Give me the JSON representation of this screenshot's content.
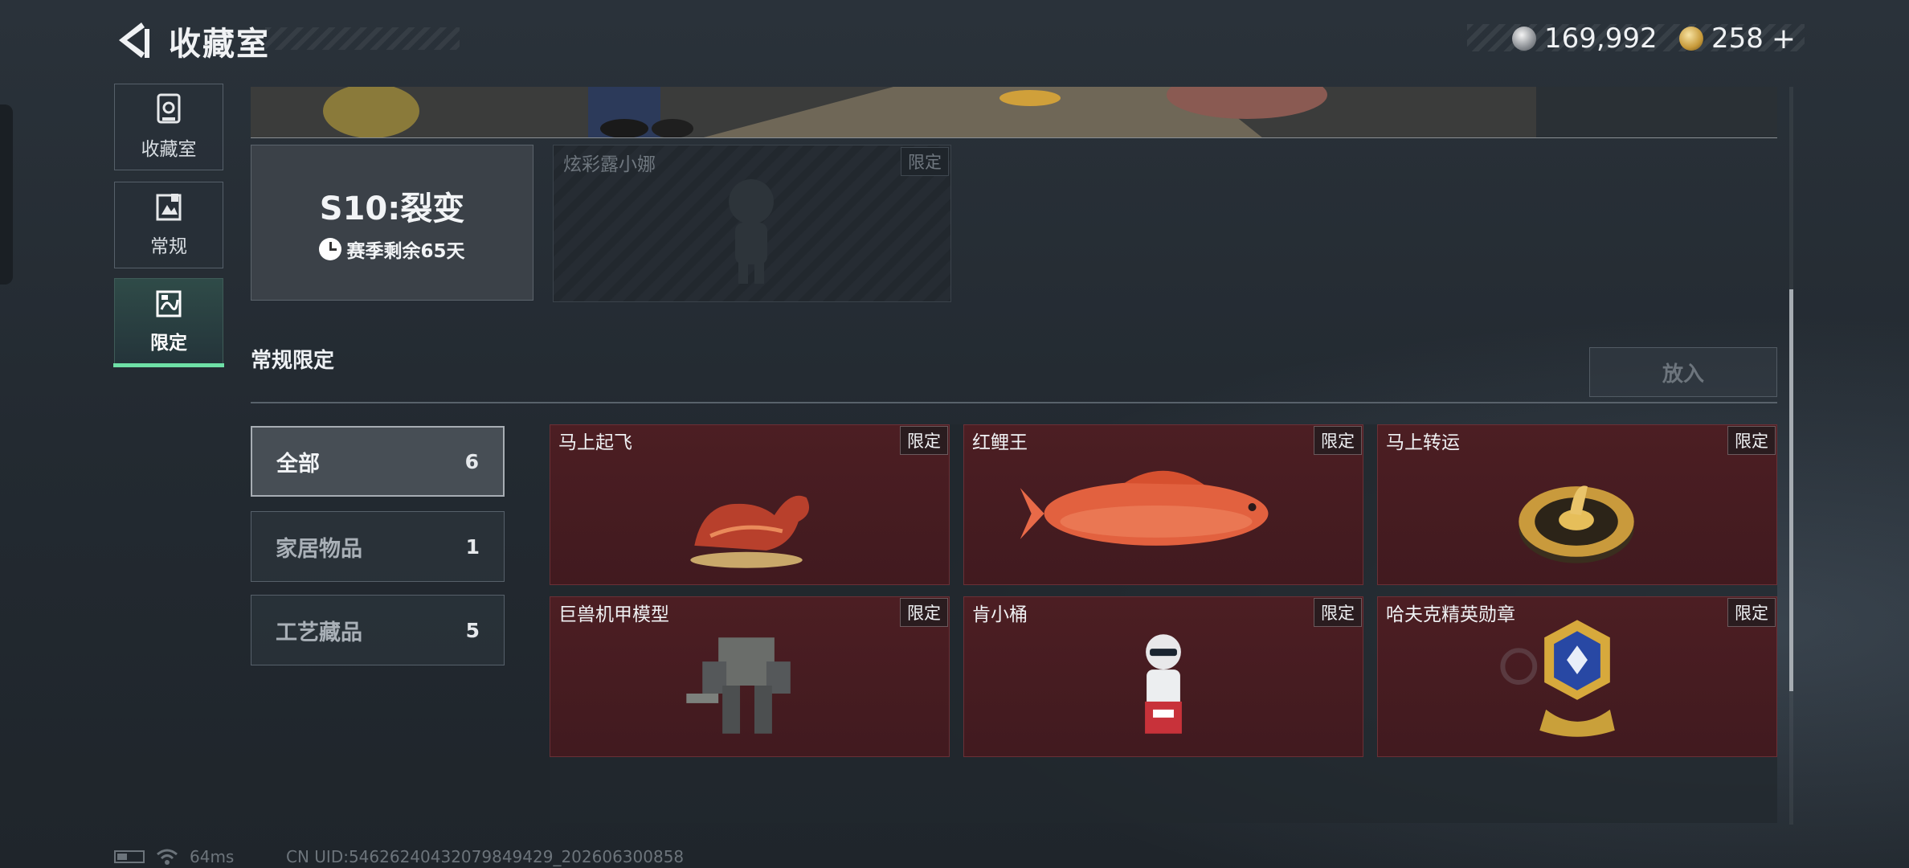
{
  "header": {
    "title": "收藏室"
  },
  "currency": {
    "silver": "169,992",
    "gold": "258",
    "add_symbol": "+"
  },
  "sidebar": {
    "items": [
      {
        "label": "收藏室",
        "icon": "collection-room-icon"
      },
      {
        "label": "常规",
        "icon": "regular-icon"
      },
      {
        "label": "限定",
        "icon": "limited-icon",
        "active": true
      }
    ]
  },
  "season": {
    "name": "S10:裂变",
    "remaining": "赛季剩余65天"
  },
  "locked_item": {
    "name": "炫彩露小娜",
    "badge": "限定"
  },
  "section": {
    "title": "常规限定",
    "put_in_label": "放入"
  },
  "filters": [
    {
      "label": "全部",
      "count": "6",
      "active": true
    },
    {
      "label": "家居物品",
      "count": "1"
    },
    {
      "label": "工艺藏品",
      "count": "5"
    }
  ],
  "items": [
    {
      "name": "马上起飞",
      "badge": "限定",
      "icon": "horse-statue-icon"
    },
    {
      "name": "红鲤王",
      "badge": "限定",
      "icon": "red-carp-icon"
    },
    {
      "name": "马上转运",
      "badge": "限定",
      "icon": "golden-wheel-icon"
    },
    {
      "name": "巨兽机甲模型",
      "badge": "限定",
      "icon": "mech-model-icon"
    },
    {
      "name": "肯小桶",
      "badge": "限定",
      "icon": "kfc-figure-icon"
    },
    {
      "name": "哈夫克精英勋章",
      "badge": "限定",
      "icon": "elite-medal-icon"
    }
  ],
  "status": {
    "ping": "64ms",
    "uid": "CN UID:5462624043207984942​9_202606300858"
  },
  "colors": {
    "accent": "#6ee0a6",
    "item_bg": "#4c1e23"
  }
}
